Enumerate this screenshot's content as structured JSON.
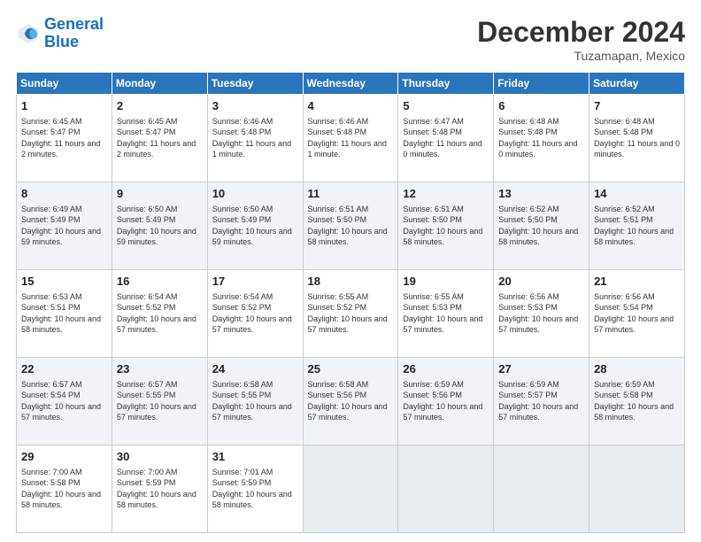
{
  "logo": {
    "line1": "General",
    "line2": "Blue"
  },
  "title": "December 2024",
  "subtitle": "Tuzamapan, Mexico",
  "days_of_week": [
    "Sunday",
    "Monday",
    "Tuesday",
    "Wednesday",
    "Thursday",
    "Friday",
    "Saturday"
  ],
  "weeks": [
    [
      {
        "day": "1",
        "sunrise": "6:45 AM",
        "sunset": "5:47 PM",
        "daylight": "11 hours and 2 minutes."
      },
      {
        "day": "2",
        "sunrise": "6:45 AM",
        "sunset": "5:47 PM",
        "daylight": "11 hours and 2 minutes."
      },
      {
        "day": "3",
        "sunrise": "6:46 AM",
        "sunset": "5:48 PM",
        "daylight": "11 hours and 1 minute."
      },
      {
        "day": "4",
        "sunrise": "6:46 AM",
        "sunset": "5:48 PM",
        "daylight": "11 hours and 1 minute."
      },
      {
        "day": "5",
        "sunrise": "6:47 AM",
        "sunset": "5:48 PM",
        "daylight": "11 hours and 0 minutes."
      },
      {
        "day": "6",
        "sunrise": "6:48 AM",
        "sunset": "5:48 PM",
        "daylight": "11 hours and 0 minutes."
      },
      {
        "day": "7",
        "sunrise": "6:48 AM",
        "sunset": "5:48 PM",
        "daylight": "11 hours and 0 minutes."
      }
    ],
    [
      {
        "day": "8",
        "sunrise": "6:49 AM",
        "sunset": "5:49 PM",
        "daylight": "10 hours and 59 minutes."
      },
      {
        "day": "9",
        "sunrise": "6:50 AM",
        "sunset": "5:49 PM",
        "daylight": "10 hours and 59 minutes."
      },
      {
        "day": "10",
        "sunrise": "6:50 AM",
        "sunset": "5:49 PM",
        "daylight": "10 hours and 59 minutes."
      },
      {
        "day": "11",
        "sunrise": "6:51 AM",
        "sunset": "5:50 PM",
        "daylight": "10 hours and 58 minutes."
      },
      {
        "day": "12",
        "sunrise": "6:51 AM",
        "sunset": "5:50 PM",
        "daylight": "10 hours and 58 minutes."
      },
      {
        "day": "13",
        "sunrise": "6:52 AM",
        "sunset": "5:50 PM",
        "daylight": "10 hours and 58 minutes."
      },
      {
        "day": "14",
        "sunrise": "6:52 AM",
        "sunset": "5:51 PM",
        "daylight": "10 hours and 58 minutes."
      }
    ],
    [
      {
        "day": "15",
        "sunrise": "6:53 AM",
        "sunset": "5:51 PM",
        "daylight": "10 hours and 58 minutes."
      },
      {
        "day": "16",
        "sunrise": "6:54 AM",
        "sunset": "5:52 PM",
        "daylight": "10 hours and 57 minutes."
      },
      {
        "day": "17",
        "sunrise": "6:54 AM",
        "sunset": "5:52 PM",
        "daylight": "10 hours and 57 minutes."
      },
      {
        "day": "18",
        "sunrise": "6:55 AM",
        "sunset": "5:52 PM",
        "daylight": "10 hours and 57 minutes."
      },
      {
        "day": "19",
        "sunrise": "6:55 AM",
        "sunset": "5:53 PM",
        "daylight": "10 hours and 57 minutes."
      },
      {
        "day": "20",
        "sunrise": "6:56 AM",
        "sunset": "5:53 PM",
        "daylight": "10 hours and 57 minutes."
      },
      {
        "day": "21",
        "sunrise": "6:56 AM",
        "sunset": "5:54 PM",
        "daylight": "10 hours and 57 minutes."
      }
    ],
    [
      {
        "day": "22",
        "sunrise": "6:57 AM",
        "sunset": "5:54 PM",
        "daylight": "10 hours and 57 minutes."
      },
      {
        "day": "23",
        "sunrise": "6:57 AM",
        "sunset": "5:55 PM",
        "daylight": "10 hours and 57 minutes."
      },
      {
        "day": "24",
        "sunrise": "6:58 AM",
        "sunset": "5:55 PM",
        "daylight": "10 hours and 57 minutes."
      },
      {
        "day": "25",
        "sunrise": "6:58 AM",
        "sunset": "5:56 PM",
        "daylight": "10 hours and 57 minutes."
      },
      {
        "day": "26",
        "sunrise": "6:59 AM",
        "sunset": "5:56 PM",
        "daylight": "10 hours and 57 minutes."
      },
      {
        "day": "27",
        "sunrise": "6:59 AM",
        "sunset": "5:57 PM",
        "daylight": "10 hours and 57 minutes."
      },
      {
        "day": "28",
        "sunrise": "6:59 AM",
        "sunset": "5:58 PM",
        "daylight": "10 hours and 58 minutes."
      }
    ],
    [
      {
        "day": "29",
        "sunrise": "7:00 AM",
        "sunset": "5:58 PM",
        "daylight": "10 hours and 58 minutes."
      },
      {
        "day": "30",
        "sunrise": "7:00 AM",
        "sunset": "5:59 PM",
        "daylight": "10 hours and 58 minutes."
      },
      {
        "day": "31",
        "sunrise": "7:01 AM",
        "sunset": "5:59 PM",
        "daylight": "10 hours and 58 minutes."
      },
      null,
      null,
      null,
      null
    ]
  ]
}
